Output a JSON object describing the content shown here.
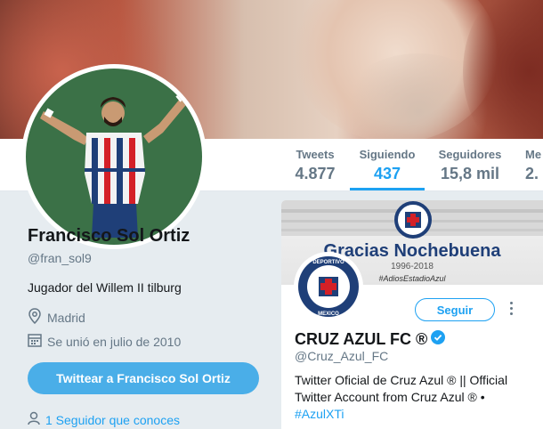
{
  "profile": {
    "name": "Francisco Sol Ortiz",
    "handle": "@fran_sol9",
    "bio": "Jugador del Willem II tilburg",
    "location": "Madrid",
    "joined": "Se unió en julio de 2010",
    "tweet_button": "Twittear a Francisco Sol Ortiz",
    "followers_you_know": "1 Seguidor que conoces"
  },
  "stats": [
    {
      "label": "Tweets",
      "value": "4.877"
    },
    {
      "label": "Siguiendo",
      "value": "437"
    },
    {
      "label": "Seguidores",
      "value": "15,8 mil"
    },
    {
      "label": "Me",
      "value": "2."
    }
  ],
  "card": {
    "banner_title": "Gracias Nochebuena",
    "banner_years": "1996-2018",
    "banner_tag": "#AdiosEstadioAzul",
    "name": "CRUZ AZUL FC ®",
    "handle": "@Cruz_Azul_FC",
    "bio": "Twitter Oficial de Cruz Azul ® || Official Twitter Account from Cruz Azul ® •",
    "hashtag": "#AzulXTi",
    "follow_button": "Seguir",
    "logo_top": "DEPORTIVO",
    "logo_bottom": "MEXICO"
  },
  "colors": {
    "accent": "#1da1f2",
    "avatar_bg": "#3b7147",
    "club_blue": "#1f3f78",
    "club_red": "#d42027"
  }
}
